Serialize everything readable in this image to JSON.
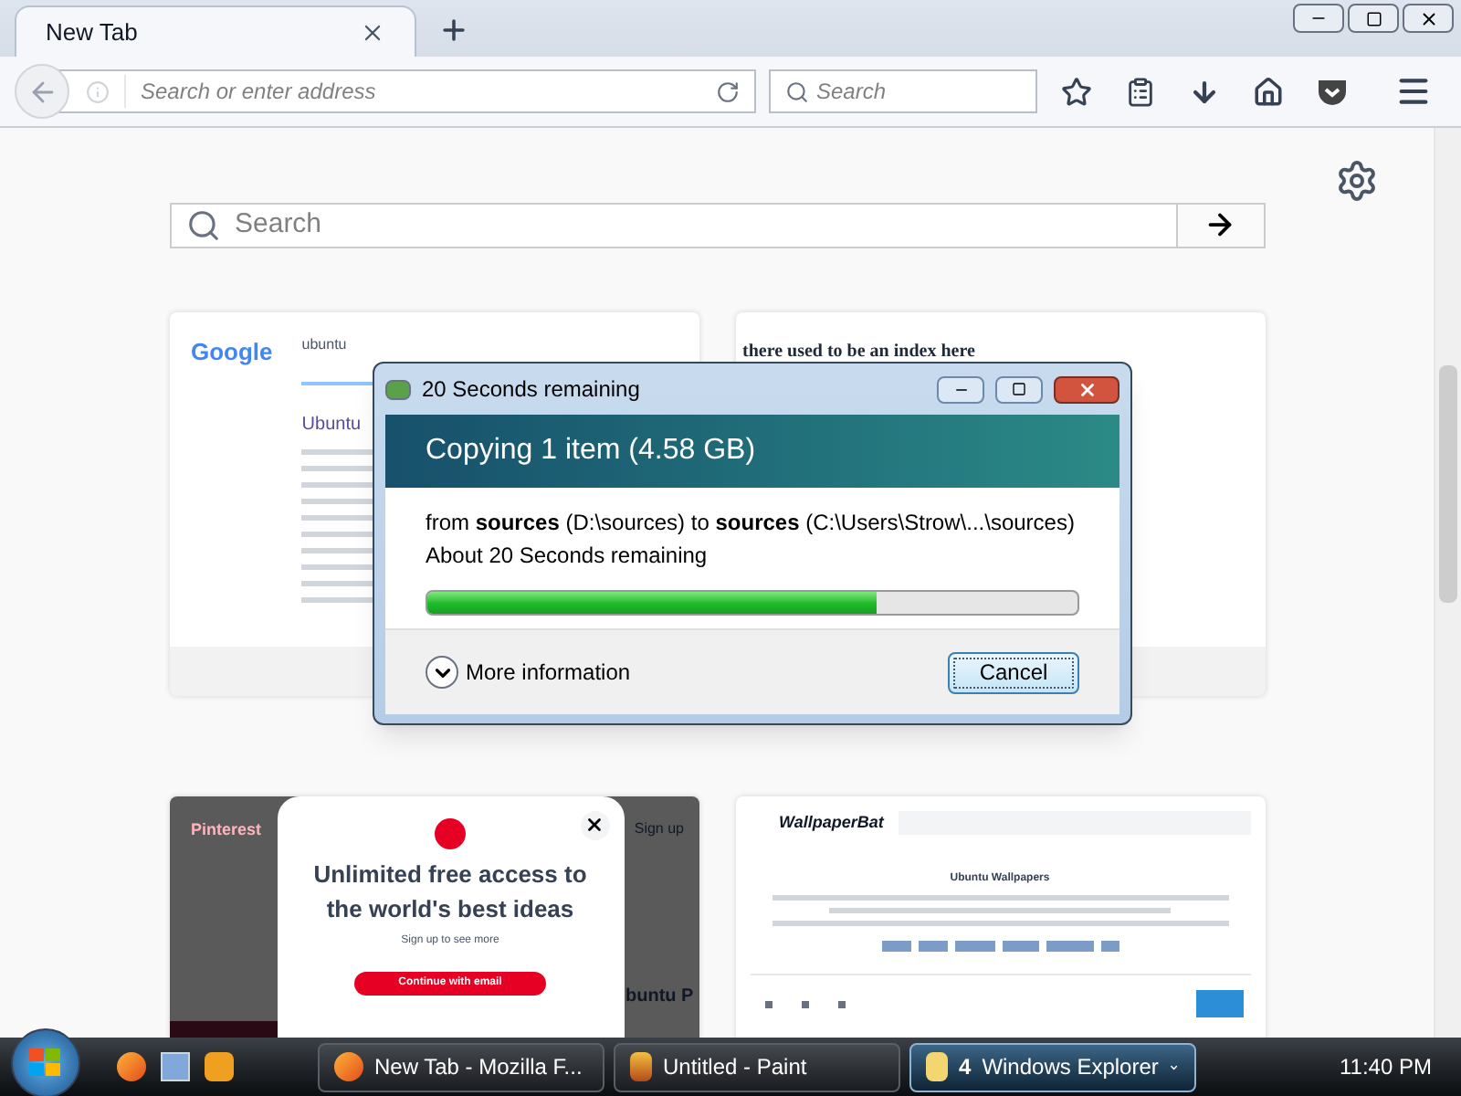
{
  "tab": {
    "title": "New Tab",
    "selected": true
  },
  "address_bar": {
    "placeholder": "Search or enter address"
  },
  "search_box": {
    "placeholder": "Search"
  },
  "page_search": {
    "placeholder": "Search"
  },
  "tiles": [
    {
      "kind": "google",
      "logo": "Google",
      "query": "ubuntu",
      "result_title": "Ubuntu"
    },
    {
      "kind": "text",
      "heading": "there used to be an index here"
    },
    {
      "kind": "pinterest",
      "brand": "Pinterest",
      "signup": "Sign up",
      "headline": "Unlimited free access to the world's best ideas",
      "subtext": "Sign up to see more",
      "button": "Continue with email",
      "behind_text": "buntu P"
    },
    {
      "kind": "wallpaperbat",
      "logo": "WallpaperBat",
      "title": "Ubuntu Wallpapers"
    }
  ],
  "dialog": {
    "title": "20 Seconds remaining",
    "header": "Copying 1 item (4.58 GB)",
    "from_line": "from **sources** (D:\\sources) to **sources** (C:\\Users\\Strow\\...\\sources)",
    "time_left": "About 20 Seconds remaining",
    "level": 0.69,
    "details": "More information",
    "cancel": "Cancel"
  },
  "taskbar": {
    "buttons": [
      {
        "kind": "firefox",
        "label": "New Tab - Mozilla F...",
        "selected": false
      },
      {
        "kind": "paint",
        "label": "Untitled - Paint",
        "selected": false
      },
      {
        "kind": "explorer",
        "count": "4",
        "label": "Windows Explorer",
        "selected": true
      }
    ],
    "clock": "11:40 PM"
  }
}
